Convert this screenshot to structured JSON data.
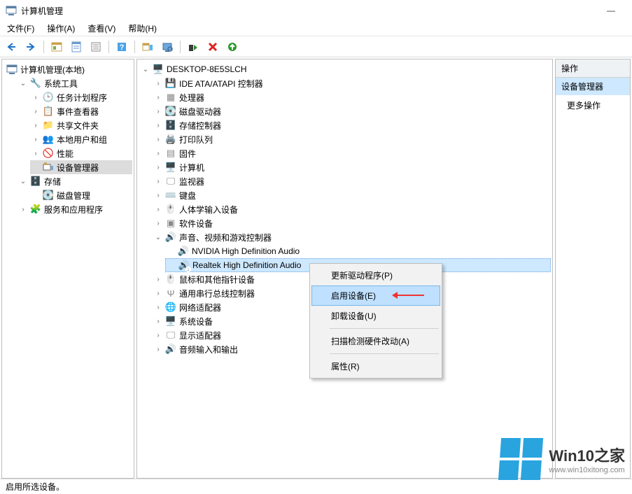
{
  "titlebar": {
    "title": "计算机管理"
  },
  "menu": {
    "file": "文件(F)",
    "action": "操作(A)",
    "view": "查看(V)",
    "help": "帮助(H)"
  },
  "left": {
    "root": "计算机管理(本地)",
    "sys_tools": "系统工具",
    "task_sched": "任务计划程序",
    "event_viewer": "事件查看器",
    "shared": "共享文件夹",
    "users": "本地用户和组",
    "perf": "性能",
    "devmgr": "设备管理器",
    "storage": "存储",
    "diskmgmt": "磁盘管理",
    "services": "服务和应用程序"
  },
  "center": {
    "root": "DESKTOP-8E5SLCH",
    "ide": "IDE ATA/ATAPI 控制器",
    "cpu": "处理器",
    "disk": "磁盘驱动器",
    "storctl": "存储控制器",
    "printq": "打印队列",
    "firmware": "固件",
    "computer": "计算机",
    "monitor": "监视器",
    "keyboard": "键盘",
    "hid": "人体学输入设备",
    "software": "软件设备",
    "sound": "声音、视频和游戏控制器",
    "nvhda": "NVIDIA High Definition Audio",
    "realtek": "Realtek High Definition Audio",
    "mouse": "鼠标和其他指针设备",
    "usb": "通用串行总线控制器",
    "net": "网络适配器",
    "sysdev": "系统设备",
    "display": "显示适配器",
    "audioio": "音频输入和输出"
  },
  "ctx": {
    "update": "更新驱动程序(P)",
    "enable": "启用设备(E)",
    "uninstall": "卸载设备(U)",
    "scan": "扫描检测硬件改动(A)",
    "props": "属性(R)"
  },
  "actions": {
    "header": "操作",
    "sel": "设备管理器",
    "more": "更多操作"
  },
  "status": "启用所选设备。",
  "watermark": {
    "brand": "Win10之家",
    "url": "www.win10xitong.com"
  }
}
